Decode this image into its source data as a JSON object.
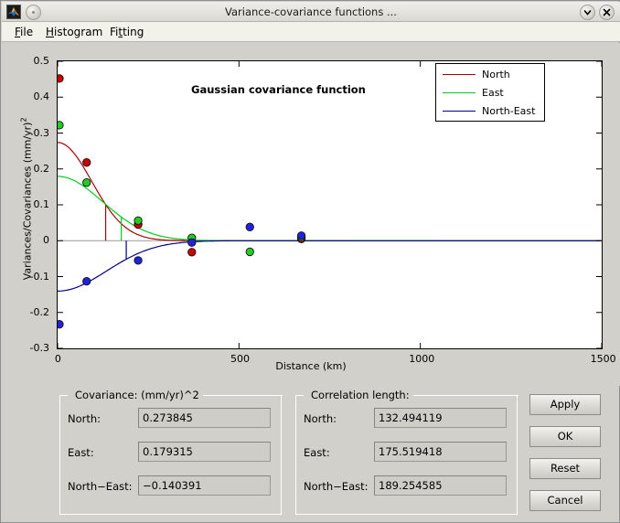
{
  "window": {
    "title": "Variance-covariance functions ...",
    "app_icon": "matlab-membrane-icon",
    "window_menu_icon": "window-menu-icon",
    "minimize_icon": "chevron-down-icon",
    "close_icon": "close-icon"
  },
  "menubar": {
    "items": [
      {
        "label": "File",
        "mnemonic": "F"
      },
      {
        "label": "Histogram",
        "mnemonic": "H"
      },
      {
        "label": "Fitting",
        "mnemonic": "t"
      }
    ]
  },
  "chart_data": {
    "type": "scatter",
    "title": "Gaussian covariance function",
    "xlabel": "Distance (km)",
    "ylabel": "Variances/Covariances (mm/yr)²",
    "xlim": [
      0,
      1500
    ],
    "ylim": [
      -0.3,
      0.5
    ],
    "xticks": [
      0,
      500,
      1000,
      1500
    ],
    "yticks": [
      -0.3,
      -0.2,
      -0.1,
      0,
      0.1,
      0.2,
      0.3,
      0.4,
      0.5
    ],
    "grid": false,
    "legend_position": "top-right",
    "zero_line": 0,
    "series": [
      {
        "name": "North",
        "color": "#aa0000",
        "marker_color": "#cc0000",
        "model": "gaussian",
        "sill": 0.273845,
        "correlation_length": 132.494119,
        "points": {
          "x": [
            5,
            80,
            215,
            225,
            370,
            672,
            672
          ],
          "y": [
            0.452,
            0.218,
            0.052,
            0.042,
            0.004,
            0.012,
            -0.002
          ]
        },
        "scatter_x": [
          5,
          80,
          222,
          370,
          672
        ],
        "scatter_y": [
          0.452,
          0.218,
          0.045,
          -0.032,
          0.005
        ]
      },
      {
        "name": "East",
        "color": "#00cc22",
        "marker_color": "#22cc22",
        "model": "gaussian",
        "sill": 0.179315,
        "correlation_length": 175.519418,
        "scatter_x": [
          5,
          80,
          222,
          370,
          530,
          672
        ],
        "scatter_y": [
          0.322,
          0.162,
          0.056,
          0.008,
          -0.031,
          0.01
        ]
      },
      {
        "name": "North-East",
        "color": "#00008b",
        "marker_color": "#2222dd",
        "model": "gaussian",
        "sill": -0.140391,
        "correlation_length": 189.254585,
        "scatter_x": [
          5,
          80,
          222,
          370,
          530,
          672
        ],
        "scatter_y": [
          -0.233,
          -0.113,
          -0.055,
          -0.005,
          0.038,
          0.014
        ]
      }
    ]
  },
  "covariance_panel": {
    "title": "Covariance: (mm/yr)^2",
    "rows": [
      {
        "label": "North:",
        "value": "0.273845"
      },
      {
        "label": "East:",
        "value": "0.179315"
      },
      {
        "label": "North−East:",
        "value": "−0.140391"
      }
    ]
  },
  "correlation_panel": {
    "title": "Correlation length:",
    "rows": [
      {
        "label": "North:",
        "value": "132.494119"
      },
      {
        "label": "East:",
        "value": "175.519418"
      },
      {
        "label": "North−East:",
        "value": "189.254585"
      }
    ]
  },
  "buttons": {
    "apply": "Apply",
    "ok": "OK",
    "reset": "Reset",
    "cancel": "Cancel"
  },
  "colors": {
    "window_bg": "#d2d0cb",
    "titlebar_bg": "#e6e4de",
    "menubar_bg": "#f2f1ea",
    "plot_bg": "#ffffff",
    "north": "#aa0000",
    "east": "#00cc22",
    "north_east": "#00008b"
  }
}
